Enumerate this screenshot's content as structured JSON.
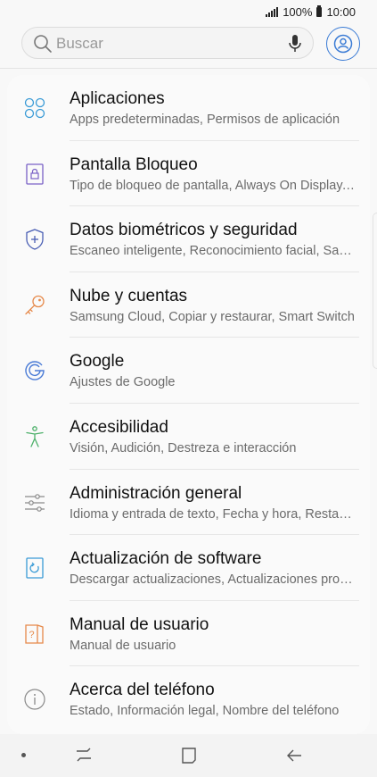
{
  "status_bar": {
    "battery": "100%",
    "time": "10:00"
  },
  "search": {
    "placeholder": "Buscar"
  },
  "settings": [
    {
      "title": "Aplicaciones",
      "subtitle": "Apps predeterminadas, Permisos de aplicación",
      "icon": "apps-icon",
      "color": "#3a9bd6"
    },
    {
      "title": "Pantalla Bloqueo",
      "subtitle": "Tipo de bloqueo de pantalla, Always On Display, Reloj y FaceWidgets",
      "icon": "lock-icon",
      "color": "#7a62c6"
    },
    {
      "title": "Datos biométricos y seguridad",
      "subtitle": "Escaneo inteligente, Reconocimiento facial, Sa…",
      "icon": "shield-icon",
      "color": "#4a5fb4"
    },
    {
      "title": "Nube y cuentas",
      "subtitle": "Samsung Cloud, Copiar y restaurar, Smart Switch",
      "icon": "key-icon",
      "color": "#e6894a"
    },
    {
      "title": "Google",
      "subtitle": "Ajustes de Google",
      "icon": "google-icon",
      "color": "#4a7bd6"
    },
    {
      "title": "Accesibilidad",
      "subtitle": "Visión, Audición, Destreza e interacción",
      "icon": "accessibility-icon",
      "color": "#4db06a"
    },
    {
      "title": "Administración general",
      "subtitle": "Idioma y entrada de texto, Fecha y hora, Restablecer",
      "icon": "sliders-icon",
      "color": "#8a8a8a"
    },
    {
      "title": "Actualización de software",
      "subtitle": "Descargar actualizaciones, Actualizaciones programadas",
      "icon": "update-icon",
      "color": "#3a9bd6"
    },
    {
      "title": "Manual de usuario",
      "subtitle": "Manual de usuario",
      "icon": "manual-icon",
      "color": "#e6894a"
    },
    {
      "title": "Acerca del teléfono",
      "subtitle": "Estado, Información legal, Nombre del teléfono",
      "icon": "info-icon",
      "color": "#8a8a8a"
    }
  ]
}
